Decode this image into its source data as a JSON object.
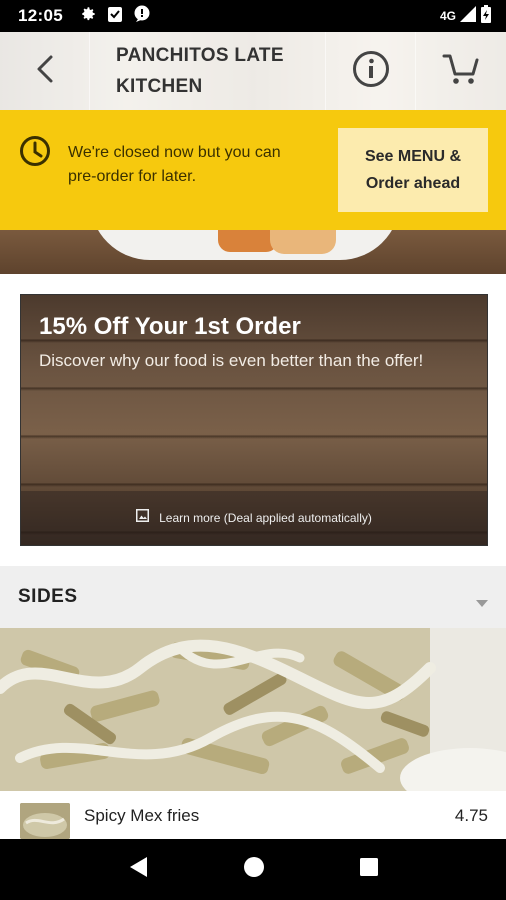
{
  "status_bar": {
    "time": "12:05",
    "network": "4G",
    "icons": [
      "settings-icon",
      "clipboard-icon",
      "chat-icon",
      "signal-icon",
      "battery-icon"
    ]
  },
  "header": {
    "title_line1": "PANCHITOS LATE",
    "title_line2": "KITCHEN",
    "icons": [
      "back-icon",
      "info-icon",
      "cart-icon"
    ]
  },
  "closed_banner": {
    "message_line1": "We're closed now but you can",
    "message_line2": "pre-order for later.",
    "button_line1": "See MENU &",
    "button_line2": "Order ahead",
    "color": "#f6c90e"
  },
  "offer": {
    "title": "15% Off Your 1st Order",
    "subtitle": "Discover why our food is even better than the offer!",
    "footer_text": "Learn more (Deal applied automatically)"
  },
  "sides": {
    "title": "SIDES"
  },
  "menu_items": [
    {
      "name": "Spicy Mex fries",
      "price": "4.75"
    }
  ]
}
